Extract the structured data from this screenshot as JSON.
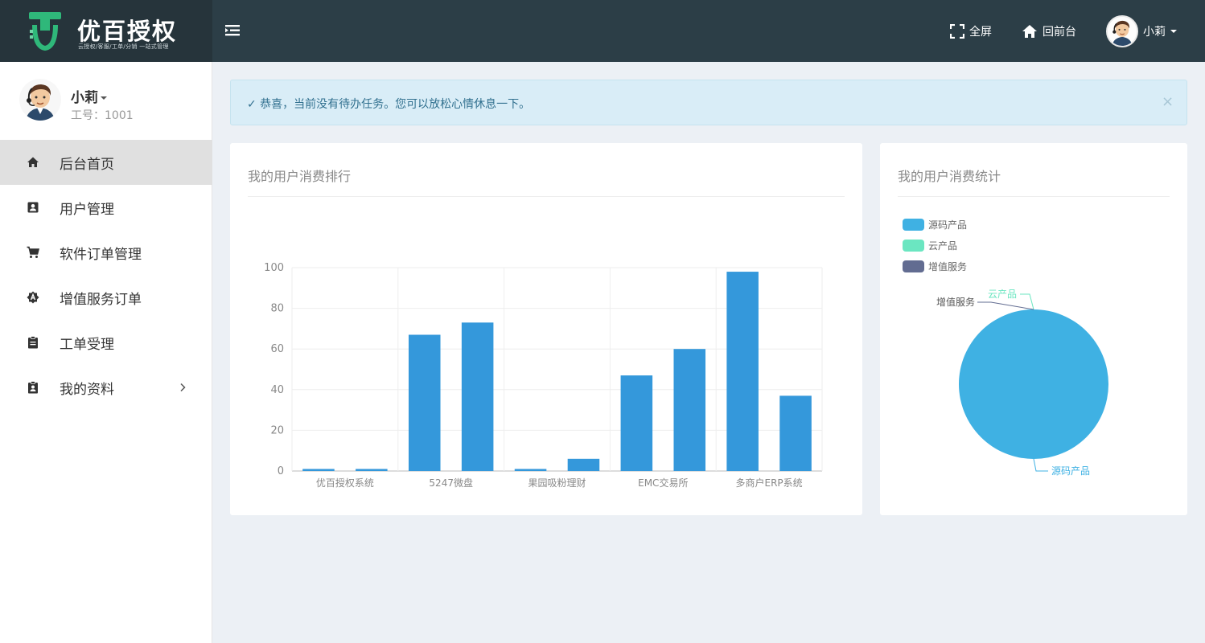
{
  "brand": {
    "name": "优百授权",
    "tagline": "云授权/客服/工单/分销 一站式管理"
  },
  "header": {
    "fullscreen_label": "全屏",
    "front_label": "回前台",
    "user_name": "小莉"
  },
  "sidebar": {
    "user_name": "小莉",
    "user_id": "工号：1001",
    "items": [
      {
        "label": "后台首页",
        "icon": "home-icon",
        "active": true
      },
      {
        "label": "用户管理",
        "icon": "user-card-icon"
      },
      {
        "label": "软件订单管理",
        "icon": "cart-icon"
      },
      {
        "label": "增值服务订单",
        "icon": "service-badge-icon"
      },
      {
        "label": "工单受理",
        "icon": "clipboard-icon"
      },
      {
        "label": "我的资料",
        "icon": "profile-icon",
        "has_children": true
      }
    ]
  },
  "alert": {
    "text": "✓ 恭喜，当前没有待办任务。您可以放松心情休息一下。",
    "close": "×",
    "color": "#31708f"
  },
  "bar_panel": {
    "title": "我的用户消费排行"
  },
  "pie_panel": {
    "title": "我的用户消费统计"
  },
  "chart_data": [
    {
      "type": "bar",
      "title": "我的用户消费排行",
      "category_tick_labels": [
        "优百授权系统",
        "5247微盘",
        "果园吸粉理财",
        "EMC交易所",
        "多商户ERP系统"
      ],
      "values": [
        1,
        1,
        67,
        73,
        1,
        6,
        47,
        60,
        98,
        37
      ],
      "ylim": [
        0,
        100
      ],
      "yticks": [
        0,
        20,
        40,
        60,
        80,
        100
      ],
      "color": "#3498db",
      "grid": true
    },
    {
      "type": "pie",
      "title": "我的用户消费统计",
      "legend_position": "top-left",
      "slices": [
        {
          "name": "源码产品",
          "value": 100,
          "color": "#3fb1e3"
        },
        {
          "name": "云产品",
          "value": 0,
          "color": "#6be6c1"
        },
        {
          "name": "增值服务",
          "value": 0,
          "color": "#626c91"
        }
      ]
    }
  ]
}
